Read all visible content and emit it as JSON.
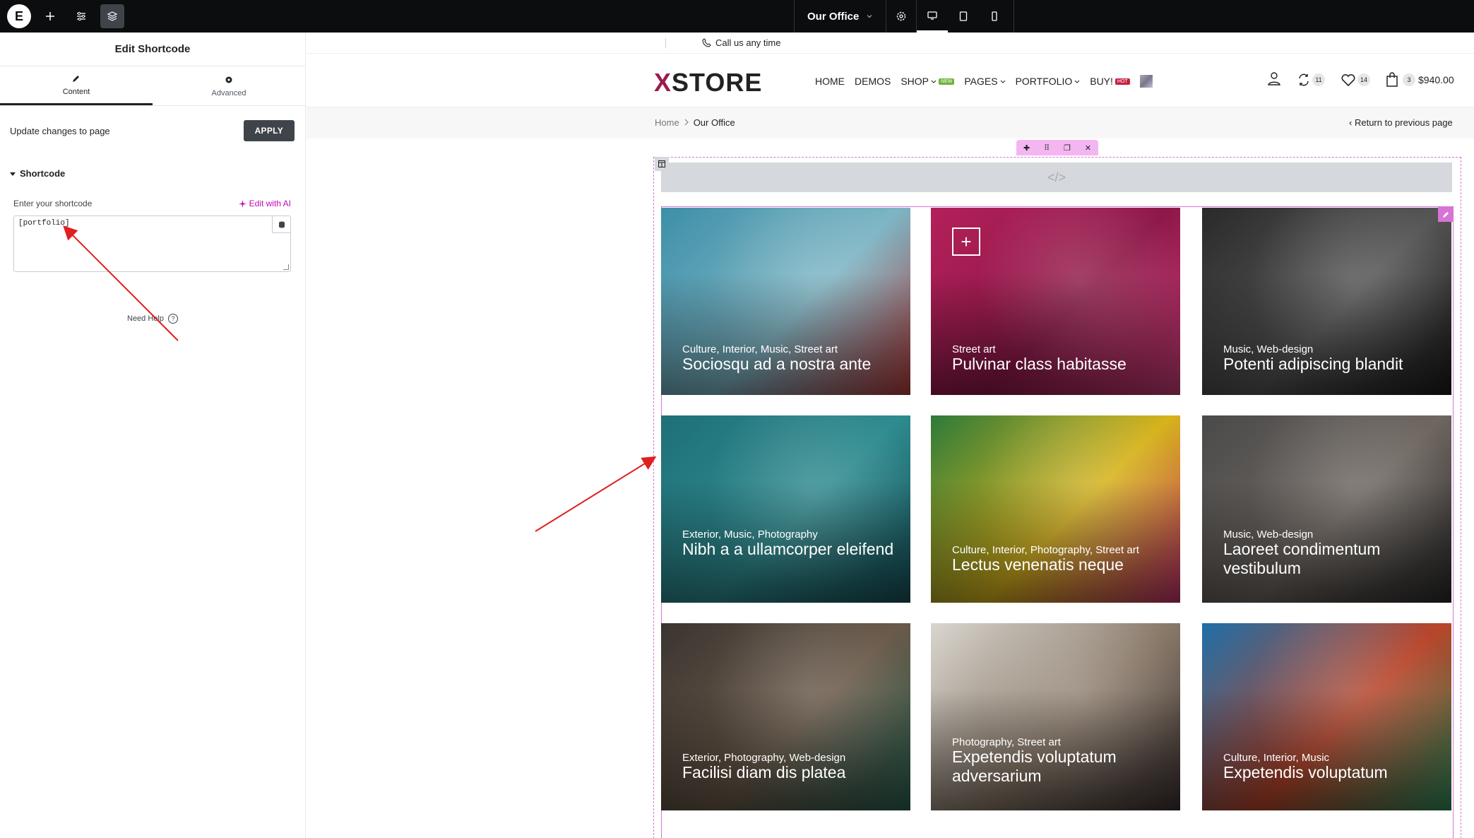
{
  "topbar": {
    "logo": "E",
    "page_name": "Our Office"
  },
  "panel": {
    "title": "Edit Shortcode",
    "tabs": [
      {
        "label": "Content"
      },
      {
        "label": "Advanced"
      }
    ],
    "update_text": "Update changes to page",
    "apply_label": "APPLY",
    "section_title": "Shortcode",
    "field_label": "Enter your shortcode",
    "edit_ai_label": "Edit with AI",
    "shortcode_value": "[portfolio]",
    "need_help": "Need Help"
  },
  "site": {
    "call_text": "Call us any time",
    "logo_x": "X",
    "logo_rest": "STORE",
    "menu": [
      {
        "label": "HOME"
      },
      {
        "label": "DEMOS"
      },
      {
        "label": "SHOP",
        "badge": "NEW"
      },
      {
        "label": "PAGES"
      },
      {
        "label": "PORTFOLIO"
      },
      {
        "label": "BUY!",
        "badge": "HOT"
      }
    ],
    "compare_count": "11",
    "wishlist_count": "14",
    "cart_count": "3",
    "cart_total": "$940.00",
    "breadcrumb_home": "Home",
    "breadcrumb_current": "Our Office",
    "return_link": "Return to previous page"
  },
  "portfolio": [
    {
      "category": "Culture, Interior, Music, Street art",
      "title": "Sociosqu ad a nostra ante",
      "colors": [
        "#3d8fa8",
        "#7db5c4",
        "#b33a3a"
      ]
    },
    {
      "category": "Street art",
      "title": "Pulvinar class habitasse",
      "colors": [
        "#b3205a",
        "#8e1848",
        "#c83c76"
      ]
    },
    {
      "category": "Music, Web-design",
      "title": "Potenti adipiscing blandit",
      "colors": [
        "#2a2a2a",
        "#555555",
        "#1a1a1a"
      ]
    },
    {
      "category": "Exterior, Music, Photography",
      "title": "Nibh a a ullamcorper eleifend",
      "colors": [
        "#1f6f78",
        "#2e8b8f",
        "#174e55"
      ]
    },
    {
      "category": "Culture, Interior, Photography, Street art",
      "title": "Lectus venenatis neque",
      "colors": [
        "#2d7a3a",
        "#d6b31c",
        "#c0306a"
      ]
    },
    {
      "category": "Music, Web-design",
      "title": "Laoreet condimentum vestibulum",
      "colors": [
        "#4a4a4a",
        "#6e6660",
        "#2a2a2a"
      ]
    },
    {
      "category": "Exterior, Photography, Web-design",
      "title": "Facilisi diam dis platea",
      "colors": [
        "#3a3430",
        "#6a5a4a",
        "#2a6050"
      ]
    },
    {
      "category": "Photography, Street art",
      "title": "Expetendis voluptatum adversarium",
      "colors": [
        "#d9d6cf",
        "#8a7a6a",
        "#3a3030"
      ]
    },
    {
      "category": "Culture, Interior, Music",
      "title": "Expetendis voluptatum",
      "colors": [
        "#1e6fa8",
        "#b8452a",
        "#2e8a5a"
      ]
    }
  ]
}
